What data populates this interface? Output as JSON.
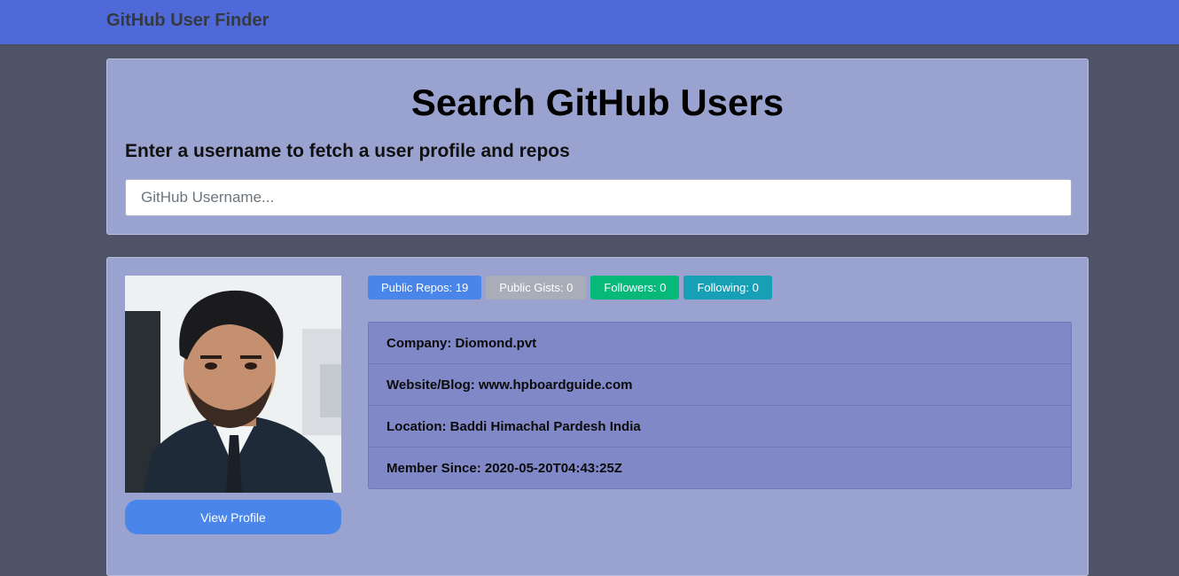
{
  "navbar": {
    "brand": "GitHub User Finder"
  },
  "search": {
    "title": "Search GitHub Users",
    "subtitle": "Enter a username to fetch a user profile and repos",
    "placeholder": "GitHub Username...",
    "value": ""
  },
  "profile": {
    "view_profile_label": "View Profile",
    "badges": [
      {
        "label": "Public Repos: 19",
        "color": "#4a86ea"
      },
      {
        "label": "Public Gists: 0",
        "color": "#a9acb9"
      },
      {
        "label": "Followers: 0",
        "color": "#06b87a"
      },
      {
        "label": "Following: 0",
        "color": "#17a0b5"
      }
    ],
    "info": [
      {
        "label": "Company: Diomond.pvt"
      },
      {
        "label": "Website/Blog: www.hpboardguide.com"
      },
      {
        "label": "Location: Baddi Himachal Pardesh India"
      },
      {
        "label": "Member Since: 2020-05-20T04:43:25Z"
      }
    ]
  },
  "colors": {
    "navbar": "#5069d8",
    "background": "#4f5368",
    "card": "#9aa3d0",
    "list": "#8088c7"
  }
}
